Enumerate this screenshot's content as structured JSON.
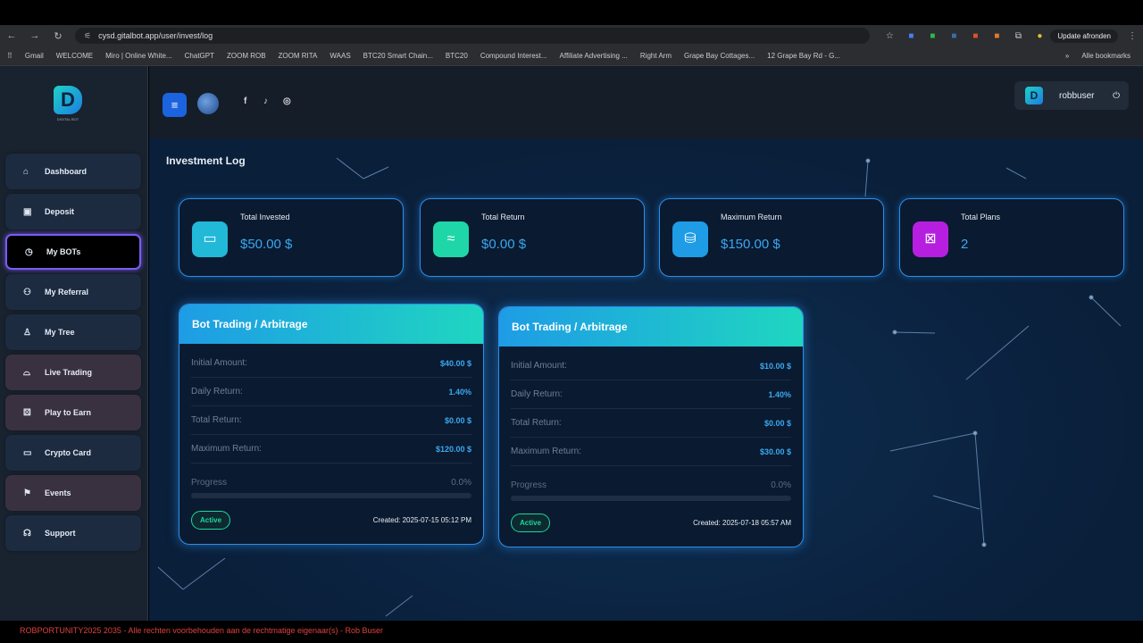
{
  "browser": {
    "url": "cysd.gitalbot.app/user/invest/log",
    "update_label": "Update afronden",
    "bookmarks": [
      "Gmail",
      "WELCOME",
      "Miro | Online White...",
      "ChatGPT",
      "ZOOM ROB",
      "ZOOM RITA",
      "WAAS",
      "BTC20 Smart Chain...",
      "BTC20",
      "Compound Interest...",
      "Affiliate Advertising ...",
      "Right Arm",
      "Grape Bay Cottages...",
      "12 Grape Bay Rd - G...",
      "Alle bookmarks"
    ]
  },
  "logo": {
    "text": "DIGITAL BOT"
  },
  "sidebar": {
    "items": [
      {
        "label": "Dashboard",
        "icon": "⌂"
      },
      {
        "label": "Deposit",
        "icon": "▣"
      },
      {
        "label": "My BOTs",
        "icon": "◷"
      },
      {
        "label": "My Referral",
        "icon": "⚇"
      },
      {
        "label": "My Tree",
        "icon": "♙"
      },
      {
        "label": "Live Trading",
        "icon": "⌓"
      },
      {
        "label": "Play to Earn",
        "icon": "⚄"
      },
      {
        "label": "Crypto Card",
        "icon": "▭"
      },
      {
        "label": "Events",
        "icon": "⚑"
      },
      {
        "label": "Support",
        "icon": "☊"
      }
    ]
  },
  "header": {
    "username": "robbuser"
  },
  "page": {
    "title": "Investment Log"
  },
  "stats": [
    {
      "label": "Total Invested",
      "value": "$50.00 $",
      "color": "#22b8d8",
      "icon": "▭"
    },
    {
      "label": "Total Return",
      "value": "$0.00 $",
      "color": "#1fd6a8",
      "icon": "≈"
    },
    {
      "label": "Maximum Return",
      "value": "$150.00 $",
      "color": "#1e9ce6",
      "icon": "⛁"
    },
    {
      "label": "Total Plans",
      "value": "2",
      "color": "#b61fe0",
      "icon": "⊠"
    }
  ],
  "bots": [
    {
      "title": "Bot Trading / Arbitrage",
      "rows": [
        {
          "k": "Initial Amount:",
          "v": "$40.00 $"
        },
        {
          "k": "Daily Return:",
          "v": "1.40%"
        },
        {
          "k": "Total Return:",
          "v": "$0.00 $"
        },
        {
          "k": "Maximum Return:",
          "v": "$120.00 $"
        }
      ],
      "progress_label": "Progress",
      "progress": "0.0%",
      "progress_value": 0,
      "status": "Active",
      "created": "Created: 2025-07-15 05:12 PM"
    },
    {
      "title": "Bot Trading / Arbitrage",
      "rows": [
        {
          "k": "Initial Amount:",
          "v": "$10.00 $"
        },
        {
          "k": "Daily Return:",
          "v": "1.40%"
        },
        {
          "k": "Total Return:",
          "v": "$0.00 $"
        },
        {
          "k": "Maximum Return:",
          "v": "$30.00 $"
        }
      ],
      "progress_label": "Progress",
      "progress": "0.0%",
      "progress_value": 0,
      "status": "Active",
      "created": "Created: 2025-07-18 05:57 AM"
    }
  ],
  "footer": {
    "text": "ROBPORTUNITY2025 2035 - Alle rechten voorbehouden aan de rechtmatige eigenaar(s) - Rob Buser"
  }
}
